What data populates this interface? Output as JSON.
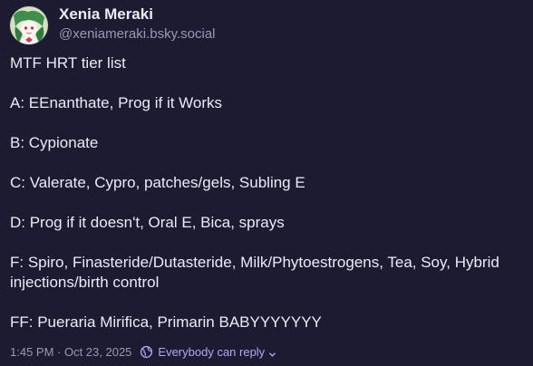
{
  "author": {
    "display_name": "Xenia Meraki",
    "handle": "@xeniameraki.bsky.social",
    "avatar_icon": "avatar-icon"
  },
  "post": {
    "paragraphs": [
      "MTF HRT tier list",
      "A: EEnanthate, Prog if it Works",
      "B: Cypionate",
      "C: Valerate, Cypro, patches/gels, Subling E",
      "D: Prog if it doesn't, Oral E, Bica, sprays",
      "F: Spiro, Finasteride/Dutasteride, Milk/Phytoestrogens, Tea, Soy, Hybrid injections/birth control",
      "FF: Pueraria Mirifica, Primarin BABYYYYYYY"
    ]
  },
  "footer": {
    "timestamp": "1:45 PM · Oct 23, 2025",
    "reply_setting_label": "Everybody can reply",
    "reply_icon": "globe-icon",
    "chevron_icon": "chevron-down-icon"
  },
  "colors": {
    "background": "#1d1b31",
    "text": "#ebeaf6",
    "muted": "#9a98b6",
    "accent": "#b3a7f9"
  }
}
